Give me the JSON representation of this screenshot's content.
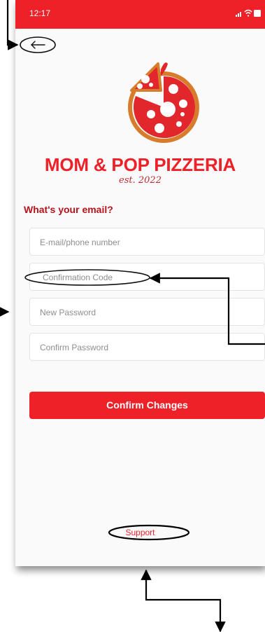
{
  "status_bar": {
    "time": "12:17",
    "signal_icon": "signal-icon",
    "wifi_icon": "wifi-icon",
    "battery_icon": "battery-icon"
  },
  "nav": {
    "back_icon": "arrow-left-icon"
  },
  "brand": {
    "name": "MOM & POP PIZZERIA",
    "established": "est. 2022",
    "logo_icon": "pizza-logo-icon"
  },
  "form": {
    "heading": "What's your email?",
    "email_placeholder": "E-mail/phone number",
    "code_placeholder": "Confirmation Code",
    "new_password_placeholder": "New Password",
    "confirm_password_placeholder": "Confirm Password",
    "submit_label": "Confirm Changes"
  },
  "footer": {
    "support_label": "Support"
  },
  "colors": {
    "accent": "#ee2128",
    "heading": "#b5121b",
    "placeholder": "#8e8e8e"
  }
}
